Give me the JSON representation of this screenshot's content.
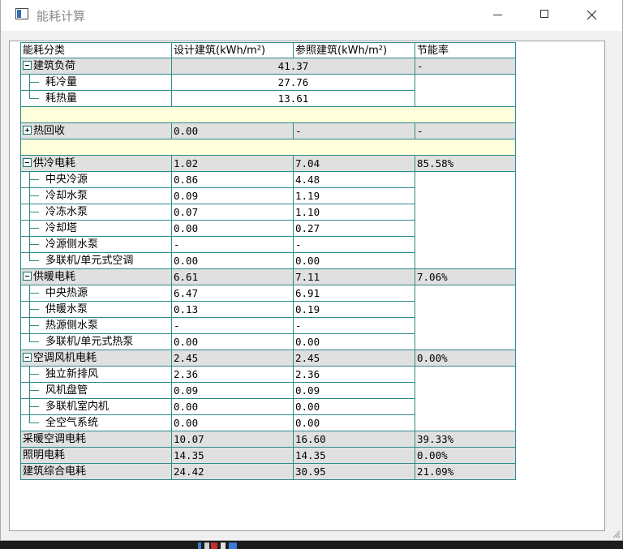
{
  "window": {
    "title": "能耗计算"
  },
  "table": {
    "headers": [
      "能耗分类",
      "设计建筑(kWh/m²)",
      "参照建筑(kWh/m²)",
      "节能率"
    ],
    "rows": [
      {
        "kind": "group",
        "toggle": "minus",
        "label": "建筑负荷",
        "merged": "41.37",
        "rate": "-"
      },
      {
        "kind": "child",
        "label": "耗冷量",
        "merged": "27.76",
        "rate": ""
      },
      {
        "kind": "child",
        "last": true,
        "label": "耗热量",
        "merged": "13.61",
        "rate": ""
      },
      {
        "kind": "sep"
      },
      {
        "kind": "group",
        "toggle": "plus",
        "label": "热回收",
        "design": "0.00",
        "ref": "-",
        "rate": "-"
      },
      {
        "kind": "sep"
      },
      {
        "kind": "group",
        "toggle": "minus",
        "label": "供冷电耗",
        "design": "1.02",
        "ref": "7.04",
        "rate": "85.58%"
      },
      {
        "kind": "child",
        "label": "中央冷源",
        "design": "0.86",
        "ref": "4.48",
        "rate": ""
      },
      {
        "kind": "child",
        "label": "冷却水泵",
        "design": "0.09",
        "ref": "1.19",
        "rate": ""
      },
      {
        "kind": "child",
        "label": "冷冻水泵",
        "design": "0.07",
        "ref": "1.10",
        "rate": ""
      },
      {
        "kind": "child",
        "label": "冷却塔",
        "design": "0.00",
        "ref": "0.27",
        "rate": ""
      },
      {
        "kind": "child",
        "label": "冷源侧水泵",
        "design": "-",
        "ref": "-",
        "rate": ""
      },
      {
        "kind": "child",
        "last": true,
        "label": "多联机/单元式空调",
        "design": "0.00",
        "ref": "0.00",
        "rate": ""
      },
      {
        "kind": "group",
        "toggle": "minus",
        "label": "供暖电耗",
        "design": "6.61",
        "ref": "7.11",
        "rate": "7.06%"
      },
      {
        "kind": "child",
        "label": "中央热源",
        "design": "6.47",
        "ref": "6.91",
        "rate": ""
      },
      {
        "kind": "child",
        "label": "供暖水泵",
        "design": "0.13",
        "ref": "0.19",
        "rate": ""
      },
      {
        "kind": "child",
        "label": "热源侧水泵",
        "design": "-",
        "ref": "-",
        "rate": ""
      },
      {
        "kind": "child",
        "last": true,
        "label": "多联机/单元式热泵",
        "design": "0.00",
        "ref": "0.00",
        "rate": ""
      },
      {
        "kind": "group",
        "toggle": "minus",
        "label": "空调风机电耗",
        "design": "2.45",
        "ref": "2.45",
        "rate": "0.00%"
      },
      {
        "kind": "child",
        "label": "独立新排风",
        "design": "2.36",
        "ref": "2.36",
        "rate": ""
      },
      {
        "kind": "child",
        "label": "风机盘管",
        "design": "0.09",
        "ref": "0.09",
        "rate": ""
      },
      {
        "kind": "child",
        "label": "多联机室内机",
        "design": "0.00",
        "ref": "0.00",
        "rate": ""
      },
      {
        "kind": "child",
        "last": true,
        "label": "全空气系统",
        "design": "0.00",
        "ref": "0.00",
        "rate": ""
      },
      {
        "kind": "summary",
        "label": "采暖空调电耗",
        "design": "10.07",
        "ref": "16.60",
        "rate": "39.33%"
      },
      {
        "kind": "summary",
        "label": "照明电耗",
        "design": "14.35",
        "ref": "14.35",
        "rate": "0.00%"
      },
      {
        "kind": "summary",
        "label": "建筑综合电耗",
        "design": "24.42",
        "ref": "30.95",
        "rate": "21.09%"
      }
    ]
  },
  "icons": {
    "app": "app-window-icon",
    "minimize": "minimize-icon",
    "maximize": "maximize-icon",
    "close": "close-icon",
    "resize": "resize-grip-icon"
  },
  "colors": {
    "grid_line": "#2e8a8a",
    "group_row": "#e0e0e0",
    "separator_row": "#ffffdc"
  }
}
